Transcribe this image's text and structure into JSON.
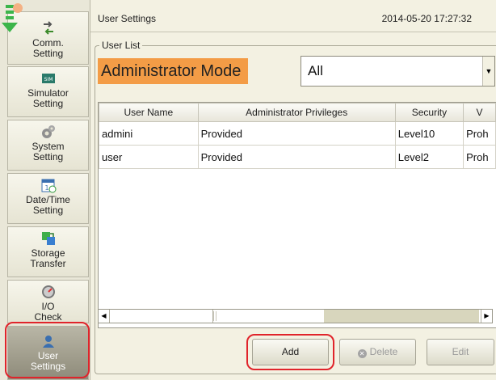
{
  "sidebar": {
    "items": [
      {
        "icon": "transfer-arrows-icon",
        "lines": [
          "Comm.",
          "Setting"
        ]
      },
      {
        "icon": "sim-card-icon",
        "lines": [
          "Simulator",
          "Setting"
        ]
      },
      {
        "icon": "gears-icon",
        "lines": [
          "System",
          "Setting"
        ]
      },
      {
        "icon": "calendar-clock-icon",
        "lines": [
          "Date/Time",
          "Setting"
        ]
      },
      {
        "icon": "storage-transfer-icon",
        "lines": [
          "Storage",
          "Transfer"
        ]
      },
      {
        "icon": "gauge-icon",
        "lines": [
          "I/O",
          "Check"
        ]
      },
      {
        "icon": "user-icon",
        "lines": [
          "User",
          "Settings"
        ]
      }
    ],
    "active_item": "User Settings"
  },
  "header": {
    "title": "User Settings",
    "datetime": "2014-05-20  17:27:32"
  },
  "user_list": {
    "legend": "User List",
    "mode_label": "Administrator Mode",
    "filter_value": "All",
    "columns": [
      "User Name",
      "Administrator Privileges",
      "Security",
      "V"
    ],
    "rows": [
      [
        "admini",
        "Provided",
        "Level10",
        "Proh"
      ],
      [
        "user",
        "Provided",
        "Level2",
        "Proh"
      ]
    ]
  },
  "buttons": {
    "add": "Add",
    "delete": "Delete",
    "edit": "Edit"
  },
  "colors": {
    "accent_orange": "#f39c46",
    "highlight_red": "#e0242b",
    "background": "#f3f1e2"
  }
}
